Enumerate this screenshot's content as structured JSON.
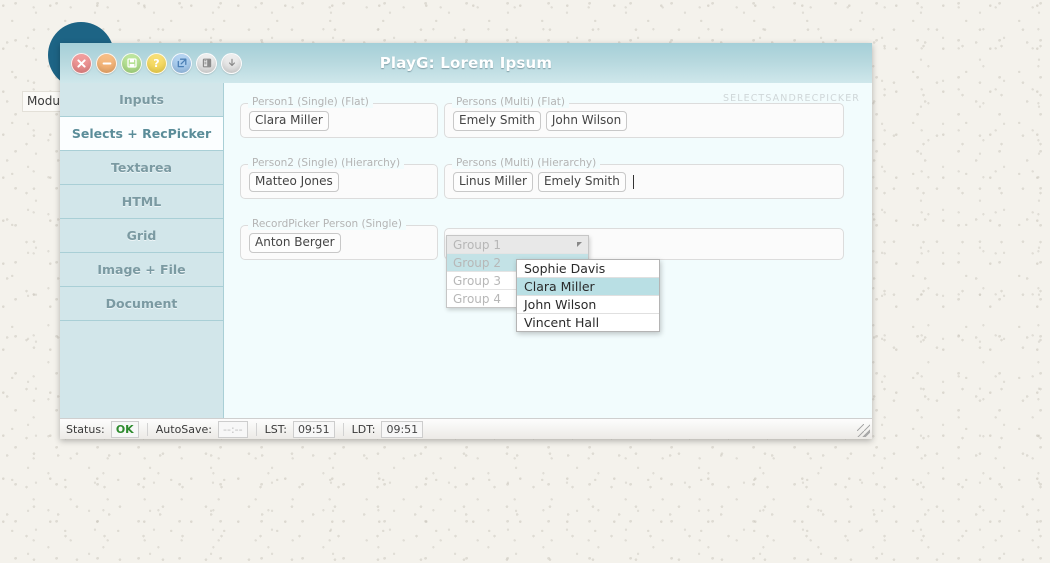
{
  "background": {
    "partial_label": "Modu"
  },
  "window": {
    "title": "PlayG: Lorem Ipsum",
    "titlebar_buttons": [
      {
        "name": "close-button",
        "glyph": "✕",
        "color": "#e58585"
      },
      {
        "name": "minimize-button",
        "glyph": "−",
        "color": "#efaa6b"
      },
      {
        "name": "save-button",
        "glyph": "Ὃe",
        "color": "#a9da84"
      },
      {
        "name": "help-button",
        "glyph": "?",
        "color": "#f2d44f"
      },
      {
        "name": "open-external-button",
        "glyph": "↗",
        "color": "#9cc3e9"
      },
      {
        "name": "notes-button",
        "glyph": "▤",
        "color": "#dcdcdc"
      },
      {
        "name": "download-button",
        "glyph": "↓",
        "color": "#dcdcdc"
      }
    ]
  },
  "sidebar": {
    "items": [
      {
        "label": "Inputs",
        "active": false
      },
      {
        "label": "Selects + RecPicker",
        "active": true
      },
      {
        "label": "Textarea",
        "active": false
      },
      {
        "label": "HTML",
        "active": false
      },
      {
        "label": "Grid",
        "active": false
      },
      {
        "label": "Image + File",
        "active": false
      },
      {
        "label": "Document",
        "active": false
      }
    ]
  },
  "content": {
    "watermark": "SELECTSANDRECPICKER",
    "fields_left": [
      {
        "legend": "Person1 (Single) (Flat)",
        "tags": [
          "Clara Miller"
        ]
      },
      {
        "legend": "Person2 (Single) (Hierarchy)",
        "tags": [
          "Matteo Jones"
        ]
      },
      {
        "legend": "RecordPicker Person (Single)",
        "tags": [
          "Anton Berger"
        ]
      }
    ],
    "fields_right": [
      {
        "legend": "Persons (Multi) (Flat)",
        "tags": [
          "Emely Smith",
          "John Wilson"
        ],
        "focused": false
      },
      {
        "legend": "Persons (Multi) (Hierarchy)",
        "tags": [
          "Linus Miller",
          "Emely Smith"
        ],
        "focused": true
      },
      {
        "legend": "",
        "tags": [],
        "focused": false
      }
    ]
  },
  "group_dropdown": {
    "items": [
      {
        "label": "Group 1",
        "state": "header",
        "has_arrow": true
      },
      {
        "label": "Group 2",
        "state": "selected",
        "has_arrow": true
      },
      {
        "label": "Group 3",
        "state": "normal",
        "has_arrow": false
      },
      {
        "label": "Group 4",
        "state": "normal",
        "has_arrow": false
      }
    ]
  },
  "person_submenu": {
    "items": [
      {
        "label": "Sophie Davis",
        "selected": false
      },
      {
        "label": "Clara Miller",
        "selected": true
      },
      {
        "label": "John Wilson",
        "selected": false
      },
      {
        "label": "Vincent Hall",
        "selected": false
      }
    ]
  },
  "statusbar": {
    "status_label": "Status:",
    "status_value": "OK",
    "autosave_label": "AutoSave:",
    "autosave_value": "--:--",
    "lst_label": "LST:",
    "lst_value": "09:51",
    "ldt_label": "LDT:",
    "ldt_value": "09:51"
  }
}
